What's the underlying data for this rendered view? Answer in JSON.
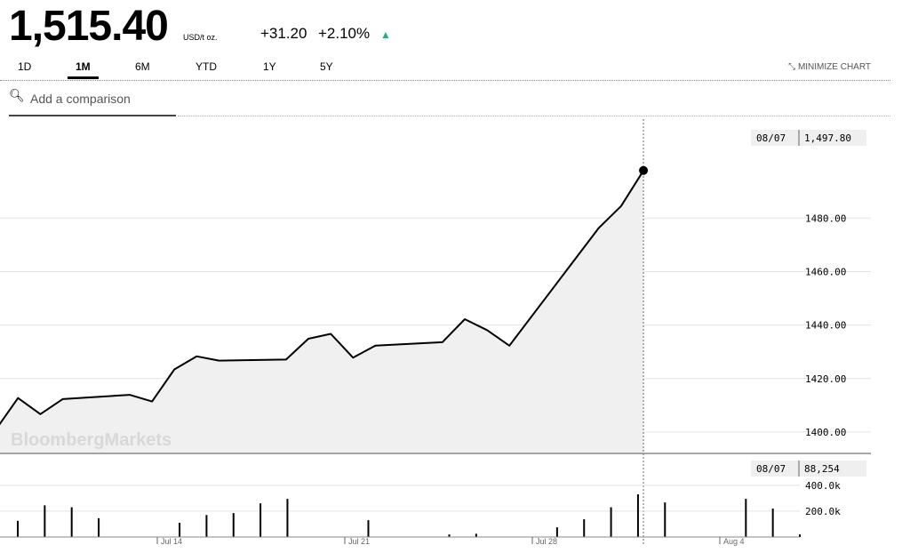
{
  "quote": {
    "price": "1,515.40",
    "unit": "USD/t oz.",
    "change": "+31.20",
    "change_pct": "+2.10%"
  },
  "tabs": [
    {
      "label": "1D",
      "active": false
    },
    {
      "label": "1M",
      "active": true
    },
    {
      "label": "6M",
      "active": false
    },
    {
      "label": "YTD",
      "active": false
    },
    {
      "label": "1Y",
      "active": false
    },
    {
      "label": "5Y",
      "active": false
    }
  ],
  "minimize_label": "MINIMIZE CHART",
  "compare_placeholder": "Add a comparison",
  "icons": {
    "search": "search-icon",
    "minimize": "minimize-icon",
    "trend": "up-arrow-icon"
  },
  "colors": {
    "up": "#1db37f",
    "line": "#000000",
    "area": "#f0f0f0"
  },
  "watermark": "BloombergMarkets",
  "chart_data": {
    "type": "area",
    "x": [
      0,
      1,
      2,
      3,
      4,
      7,
      8,
      9,
      10,
      11,
      14,
      15,
      16,
      17,
      18,
      21,
      22,
      23,
      24,
      28,
      29,
      30,
      31,
      35,
      36,
      37
    ],
    "values": [
      1400.2,
      1400.8,
      1412.7,
      1406.7,
      1412.3,
      1413.9,
      1411.4,
      1423.4,
      1428.3,
      1426.7,
      1427.1,
      1434.9,
      1436.7,
      1427.8,
      1432.3,
      1433.6,
      1442.2,
      1438.1,
      1432.3,
      1476.3,
      1484.5,
      1497.8
    ],
    "value_label": "1,497.80",
    "volumes": [
      125,
      245,
      230,
      145,
      110,
      170,
      185,
      260,
      295,
      130,
      20,
      25,
      75,
      137,
      230,
      330,
      267,
      295,
      220,
      20
    ],
    "volume_x": [
      0,
      1,
      2,
      3,
      6,
      7,
      8,
      9,
      10,
      13,
      16,
      17,
      20,
      21,
      22,
      23,
      24,
      27,
      28,
      29
    ],
    "volume_label": "88,254",
    "date_label": "08/07",
    "y_ticks": [
      "1480.00",
      "1460.00",
      "1440.00",
      "1420.00",
      "1400.00"
    ],
    "volume_ticks": [
      "400.0k",
      "200.0k"
    ],
    "x_tick_labels": [
      "Jul 14",
      "Jul 21",
      "Jul 28",
      "Aug 4"
    ],
    "ylim": [
      1392,
      1517
    ],
    "volume_ylim": [
      0,
      550
    ]
  }
}
